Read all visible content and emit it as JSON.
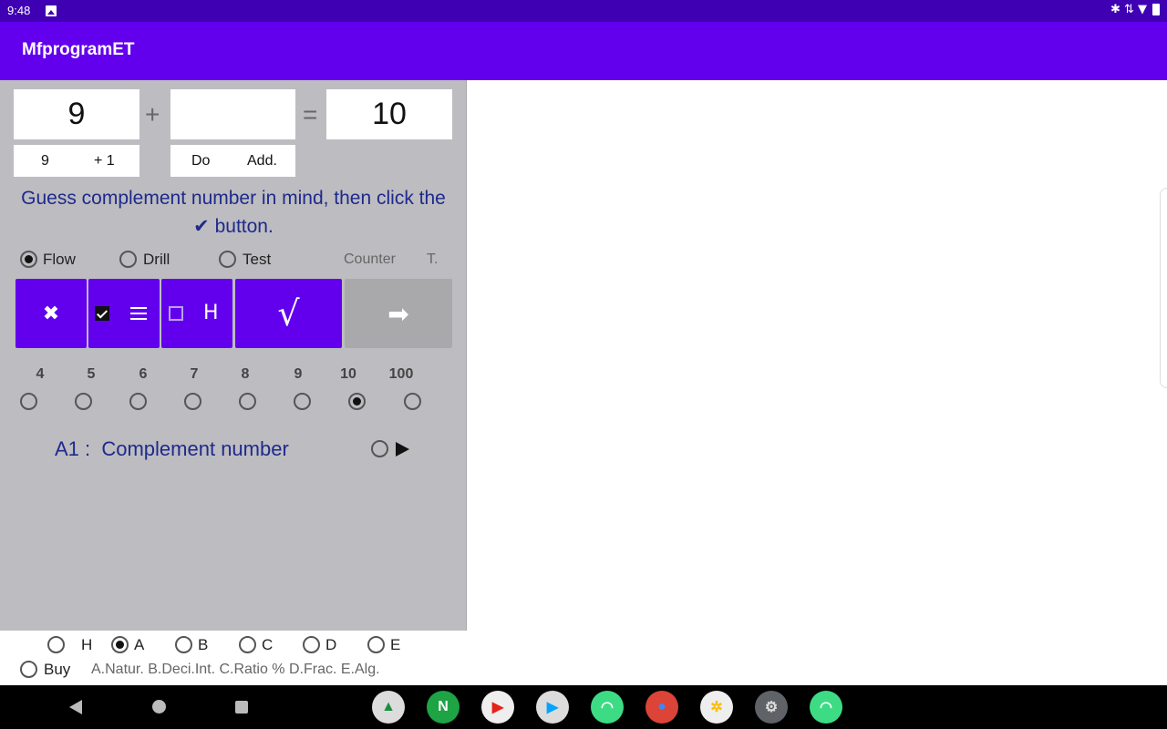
{
  "status": {
    "time": "9:48",
    "right_glyphs": "✱ ⇅ ▼"
  },
  "app": {
    "title": "MfprogramET"
  },
  "equation": {
    "left": "9",
    "plus": "+",
    "middle": "",
    "equals": "=",
    "right": "10"
  },
  "sub_boxes": {
    "left_a": "9",
    "left_b": "+ 1",
    "mid_a": "Do",
    "mid_b": "Add."
  },
  "hint": "Guess complement number in mind, then click the ✔ button.",
  "modes": {
    "flow": "Flow",
    "drill": "Drill",
    "test": "Test",
    "counter": "Counter",
    "t": "T.",
    "selected": "Flow"
  },
  "buttons": {
    "close": "✖",
    "h": "H",
    "check": "√",
    "next": "➡"
  },
  "numbers": {
    "labels": [
      "4",
      "5",
      "6",
      "7",
      "8",
      "9",
      "10",
      "100"
    ],
    "selected": "10"
  },
  "lesson": "A1 :  Complement number",
  "levels": {
    "labels": [
      "H",
      "A",
      "B",
      "C",
      "D",
      "E"
    ],
    "selected": "A"
  },
  "buy": "Buy",
  "footnote": "A.Natur. B.Deci.Int. C.Ratio % D.Frac. E.Alg.",
  "dock": [
    {
      "name": "drive-icon",
      "glyph": "▲",
      "color": "#dcdcdc",
      "fg": "#1e8e3e"
    },
    {
      "name": "n-app-icon",
      "glyph": "N",
      "color": "#1ea345",
      "fg": "#ffffff"
    },
    {
      "name": "youtube-icon",
      "glyph": "▶",
      "color": "#eeeeee",
      "fg": "#e62117"
    },
    {
      "name": "play-store-icon",
      "glyph": "▶",
      "color": "#dcdcdc",
      "fg": "#01a4ff"
    },
    {
      "name": "android-app-icon",
      "glyph": "◠",
      "color": "#3ddc84",
      "fg": "#ffffff"
    },
    {
      "name": "chrome-icon",
      "glyph": "●",
      "color": "#db4437",
      "fg": "#4285f4"
    },
    {
      "name": "photos-icon",
      "glyph": "✲",
      "color": "#eeeeee",
      "fg": "#fbbc05"
    },
    {
      "name": "settings-icon",
      "glyph": "⚙",
      "color": "#5f6368",
      "fg": "#dddddd"
    },
    {
      "name": "android-app-icon-2",
      "glyph": "◠",
      "color": "#3ddc84",
      "fg": "#ffffff"
    }
  ]
}
